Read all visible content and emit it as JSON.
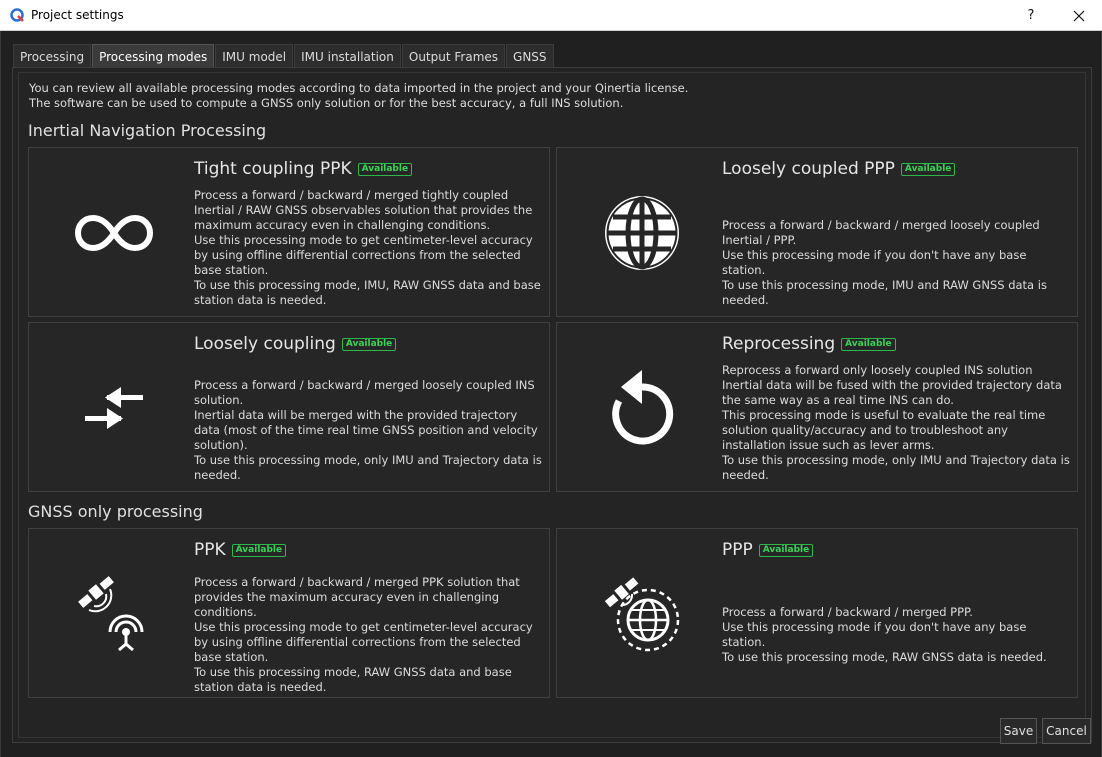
{
  "window": {
    "title": "Project settings",
    "help": "?",
    "close": "✕"
  },
  "tabs": [
    {
      "label": "Processing"
    },
    {
      "label": "Processing modes"
    },
    {
      "label": "IMU model"
    },
    {
      "label": "IMU installation"
    },
    {
      "label": "Output Frames"
    },
    {
      "label": "GNSS"
    }
  ],
  "active_tab": "Processing modes",
  "intro": {
    "line1": "You can review all available processing modes according to data imported in the project and your Qinertia license.",
    "line2": "The software can be used to compute a GNSS only solution or for the best accuracy, a full INS solution."
  },
  "sections": {
    "ins": "Inertial Navigation Processing",
    "gnss": "GNSS only processing"
  },
  "badge_label": "Available",
  "cards": {
    "tight": {
      "title": "Tight coupling PPK",
      "icon": "infinity-icon",
      "desc": [
        "Process a forward / backward / merged tightly coupled Inertial / RAW GNSS observables solution that provides the maximum accuracy even in challenging conditions.",
        "Use this processing mode to get centimeter-level accuracy by using offline differential corrections from the selected base station.",
        "To use this processing mode, IMU, RAW GNSS data and base station data is needed."
      ]
    },
    "loose_ppp": {
      "title": "Loosely coupled PPP",
      "icon": "globe-icon",
      "desc": [
        "Process a forward / backward / merged loosely coupled Inertial / PPP.",
        "Use this processing mode if you don't have any base station.",
        "To use this processing mode, IMU and RAW GNSS data is needed."
      ]
    },
    "loose": {
      "title": "Loosely coupling",
      "icon": "merge-arrows-icon",
      "desc": [
        "Process a forward / backward / merged loosely coupled INS solution.",
        "Inertial data will be merged with the provided trajectory data (most of the time real time GNSS position and velocity solution).",
        "To use this processing mode, only IMU and Trajectory data is needed."
      ]
    },
    "reproc": {
      "title": "Reprocessing",
      "icon": "rotate-arrow-icon",
      "desc": [
        "Reprocess a forward only loosely coupled INS solution",
        "Inertial data will be fused with the provided trajectory data the same way as a real time INS can do.",
        "This processing mode is useful to evaluate the real time solution quality/accuracy and to troubleshoot any installation issue such as lever arms.",
        "To use this processing mode, only IMU and Trajectory data is needed."
      ]
    },
    "ppk": {
      "title": "PPK",
      "icon": "satellite-antenna-icon",
      "desc": [
        "Process a forward / backward / merged PPK solution that provides the maximum accuracy even in challenging conditions.",
        "Use this processing mode to get centimeter-level accuracy by using offline differential corrections from the selected base station.",
        "To use this processing mode, RAW GNSS data and base station data is needed."
      ]
    },
    "ppp": {
      "title": "PPP",
      "icon": "satellite-globe-icon",
      "desc": [
        "Process a forward / backward / merged PPP.",
        "Use this processing mode if you don't have any base station.",
        "To use this processing mode, RAW GNSS data is needed."
      ]
    }
  },
  "footer": {
    "save": "Save",
    "cancel": "Cancel"
  }
}
